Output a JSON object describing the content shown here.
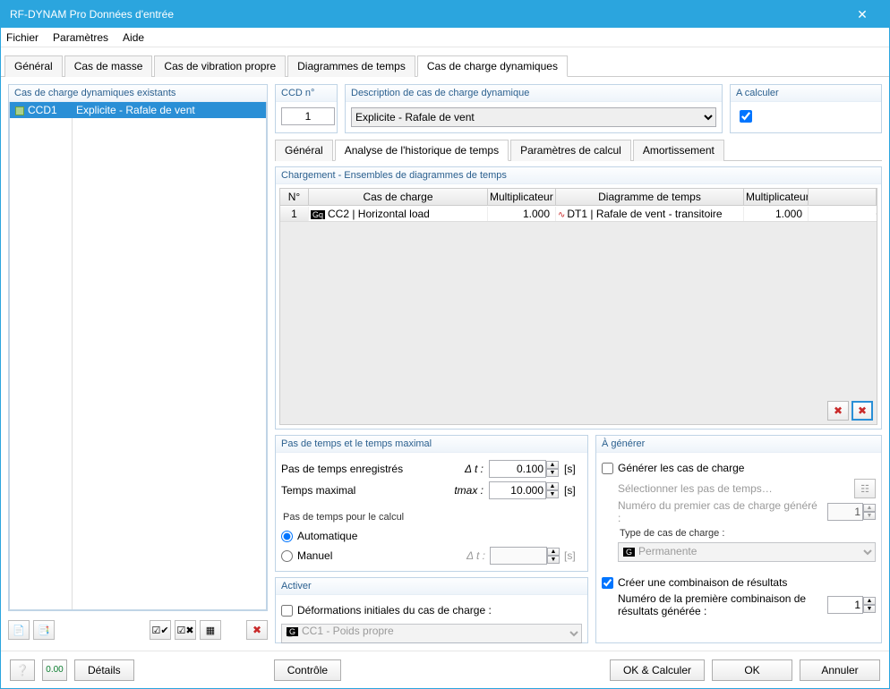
{
  "window": {
    "title": "RF-DYNAM Pro Données d'entrée",
    "close": "✕"
  },
  "menu": {
    "file": "Fichier",
    "params": "Paramètres",
    "help": "Aide"
  },
  "mainTabs": {
    "general": "Général",
    "mass": "Cas de masse",
    "vib": "Cas de vibration propre",
    "timediag": "Diagrammes de temps",
    "dynlc": "Cas de charge dynamiques"
  },
  "leftPane": {
    "title": "Cas de charge dynamiques existants",
    "item": {
      "id": "CCD1",
      "desc": "Explicite - Rafale de vent"
    }
  },
  "ccdno": {
    "label": "CCD n°",
    "value": "1"
  },
  "desc": {
    "label": "Description de cas de charge dynamique",
    "value": "Explicite - Rafale de vent"
  },
  "acalc": {
    "label": "A calculer"
  },
  "subTabs": {
    "general": "Général",
    "hist": "Analyse de l'historique de temps",
    "calc": "Paramètres de calcul",
    "damp": "Amortissement"
  },
  "loadTable": {
    "title": "Chargement - Ensembles de diagrammes de temps",
    "head": {
      "n": "N°",
      "lc": "Cas de charge",
      "m1": "Multiplicateur",
      "td": "Diagramme de temps",
      "m2": "Multiplicateur"
    },
    "row": {
      "n": "1",
      "lcBadge": "Gq",
      "lcText": "CC2 | Horizontal load",
      "m1": "1.000",
      "tdText": "DT1 | Rafale de vent - transitoire",
      "m2": "1.000"
    }
  },
  "timestep": {
    "title": "Pas de temps et le temps maximal",
    "saved": "Pas de temps enregistrés",
    "dt": "Δ t :",
    "dtval": "0.100",
    "sec": "[s]",
    "tmax": "Temps maximal",
    "tmaxSym": "tmax :",
    "tmaxVal": "10.000",
    "calcStep": "Pas de temps pour le calcul",
    "auto": "Automatique",
    "manual": "Manuel",
    "dt2": "Δ t :"
  },
  "activate": {
    "title": "Activer",
    "deform": "Déformations initiales du cas de charge :",
    "lcBadge": "G",
    "lcText": "CC1 - Poids propre"
  },
  "generate": {
    "title": "À générer",
    "genLC": "Générer les cas de charge",
    "selectSteps": "Sélectionner les pas de temps…",
    "firstLC": "Numéro du premier cas de charge généré :",
    "firstLCval": "1",
    "lcType": "Type de cas de charge :",
    "lcTypeBadge": "G",
    "lcTypeText": "Permanente",
    "createCombo": "Créer une combinaison de résultats",
    "firstCombo": "Numéro de la première combinaison de résultats générée :",
    "firstComboVal": "1"
  },
  "footer": {
    "details": "Détails",
    "control": "Contrôle",
    "okCalc": "OK & Calculer",
    "ok": "OK",
    "cancel": "Annuler"
  }
}
